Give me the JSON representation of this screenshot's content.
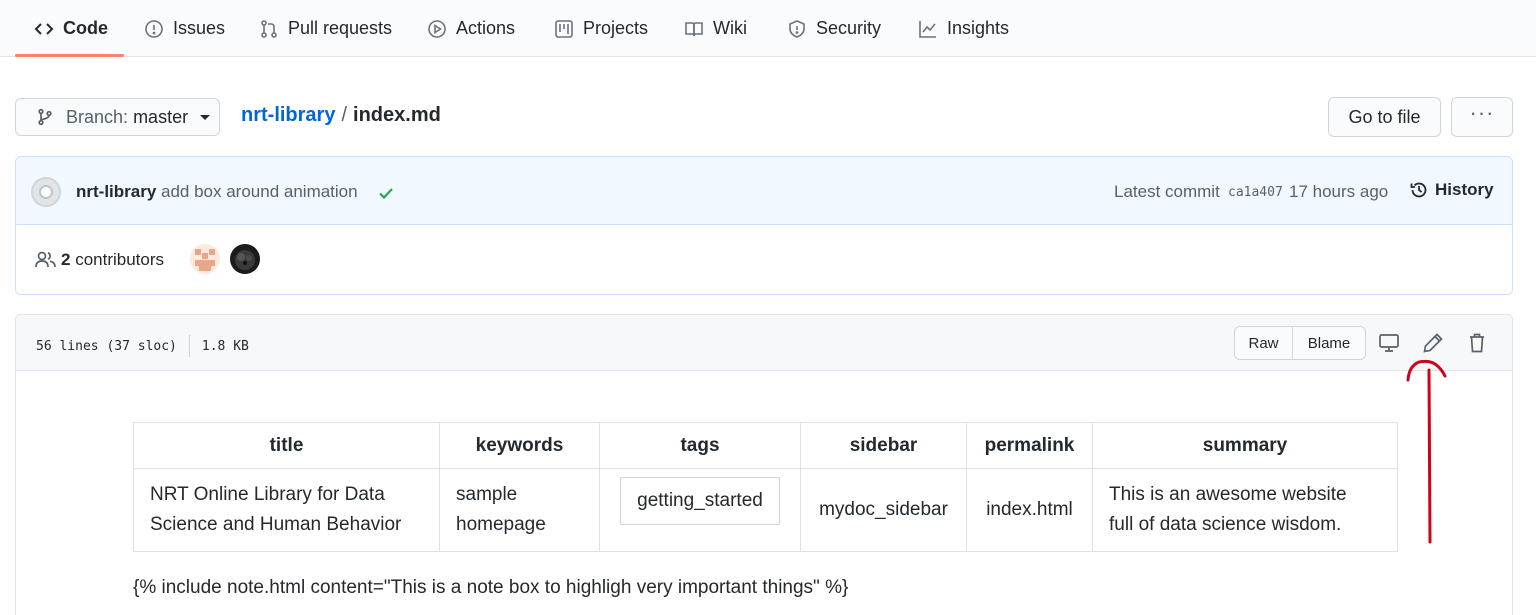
{
  "nav": {
    "tabs": [
      {
        "label": "Code",
        "icon": "code-icon",
        "selected": true
      },
      {
        "label": "Issues",
        "icon": "issue-opened-icon"
      },
      {
        "label": "Pull requests",
        "icon": "git-pull-request-icon"
      },
      {
        "label": "Actions",
        "icon": "play-icon"
      },
      {
        "label": "Projects",
        "icon": "project-icon"
      },
      {
        "label": "Wiki",
        "icon": "book-icon"
      },
      {
        "label": "Security",
        "icon": "shield-icon"
      },
      {
        "label": "Insights",
        "icon": "graph-icon"
      }
    ],
    "accent": "#f9826c"
  },
  "branch": {
    "label": "Branch:",
    "name": "master"
  },
  "breadcrumb": {
    "repo": "nrt-library",
    "separator": "/",
    "file": "index.md"
  },
  "actions": {
    "go_to_file": "Go to file",
    "more": "···"
  },
  "commit": {
    "author": "nrt-library",
    "message": "add box around animation",
    "status": "success",
    "latest_label": "Latest commit",
    "sha": "ca1a407",
    "time": "17 hours ago",
    "history_label": "History"
  },
  "contributors": {
    "count": "2",
    "label": "contributors"
  },
  "file": {
    "lines": "56 lines (37 sloc)",
    "size": "1.8 KB",
    "raw_label": "Raw",
    "blame_label": "Blame"
  },
  "frontmatter": {
    "headers": [
      "title",
      "keywords",
      "tags",
      "sidebar",
      "permalink",
      "summary"
    ],
    "row": {
      "title_l1": "NRT Online Library for Data",
      "title_l2": "Science and Human Behavior",
      "keywords_l1": "sample",
      "keywords_l2": "homepage",
      "tags": "getting_started",
      "sidebar": "mydoc_sidebar",
      "permalink": "index.html",
      "summary_l1": "This is an awesome website",
      "summary_l2": "full of data science wisdom."
    }
  },
  "body_line": "{% include note.html content=\"This is a note box to highligh very important things\" %}",
  "colors": {
    "link": "#0366d6",
    "success": "#28a745",
    "annotation": "#d0021b"
  }
}
